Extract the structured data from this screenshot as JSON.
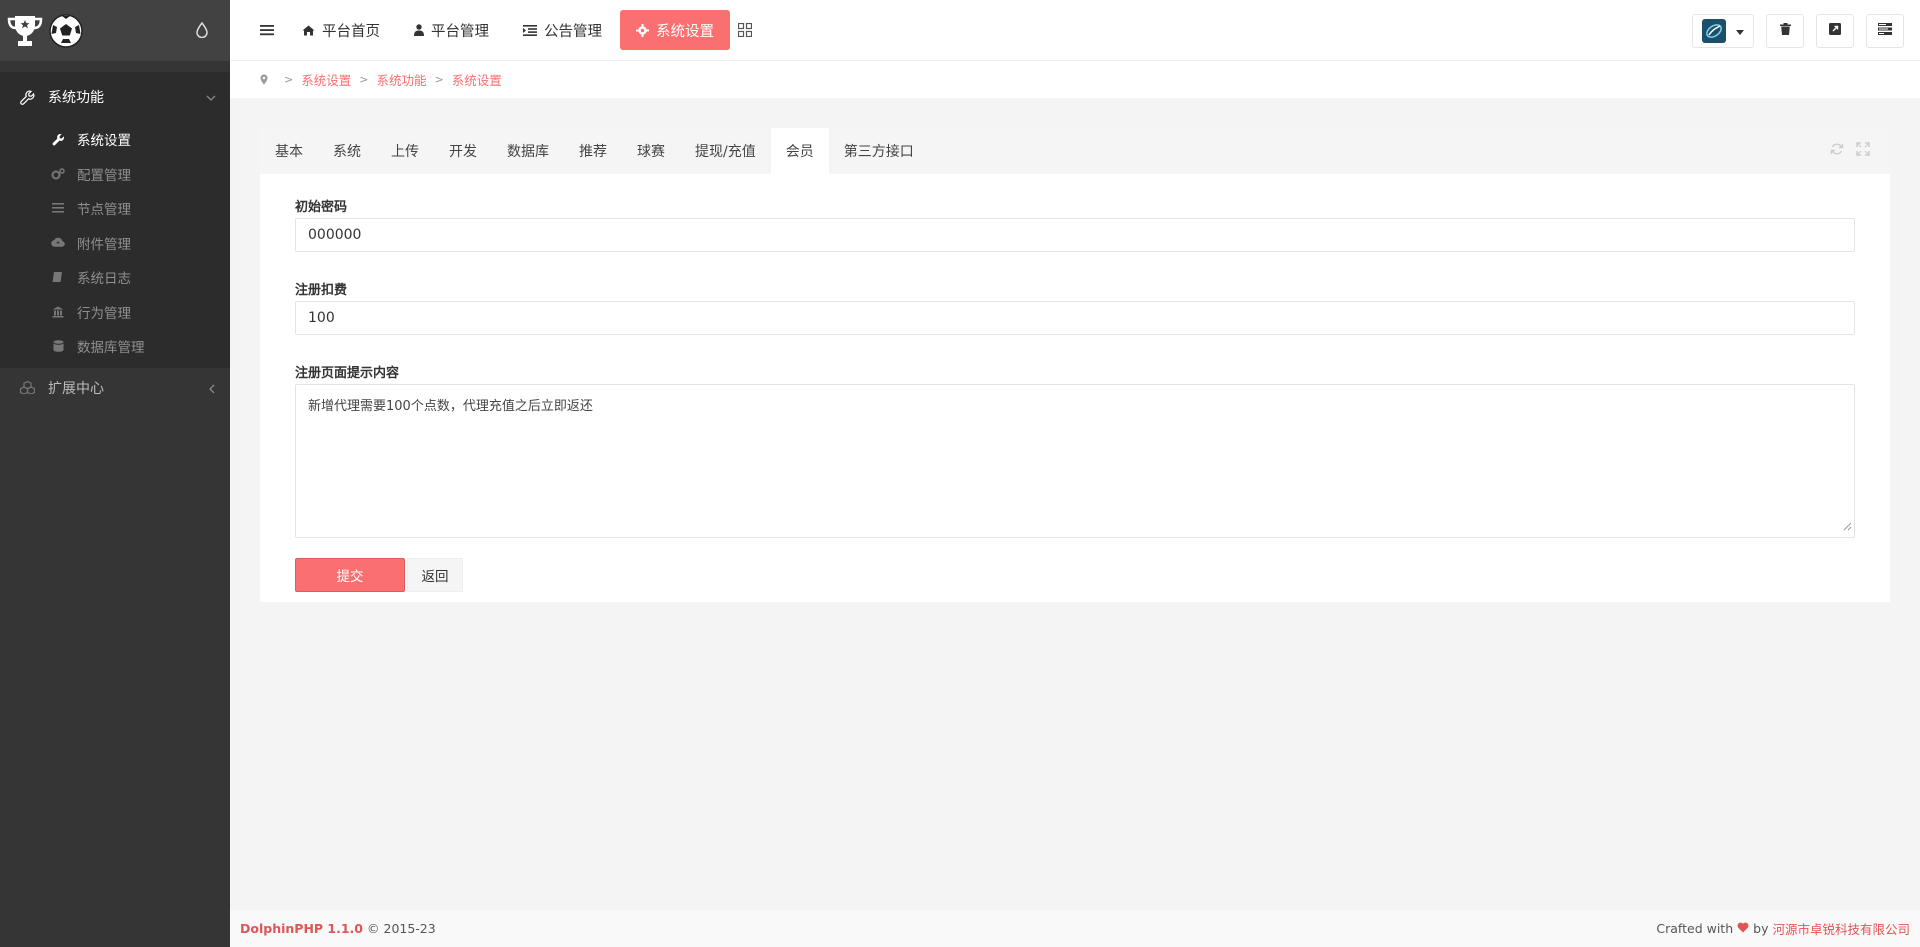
{
  "sidebar": {
    "group_label": "系统功能",
    "items": [
      {
        "label": "系统设置"
      },
      {
        "label": "配置管理"
      },
      {
        "label": "节点管理"
      },
      {
        "label": "附件管理"
      },
      {
        "label": "系统日志"
      },
      {
        "label": "行为管理"
      },
      {
        "label": "数据库管理"
      }
    ],
    "group2_label": "扩展中心"
  },
  "topnav": {
    "items": [
      {
        "label": "平台首页",
        "icon": "home-icon"
      },
      {
        "label": "平台管理",
        "icon": "user-icon"
      },
      {
        "label": "公告管理",
        "icon": "list-indent-icon"
      },
      {
        "label": "系统设置",
        "icon": "gear-icon"
      }
    ],
    "active": "系统设置"
  },
  "breadcrumb": [
    "系统设置",
    "系统功能",
    "系统设置"
  ],
  "tabs": [
    "基本",
    "系统",
    "上传",
    "开发",
    "数据库",
    "推荐",
    "球赛",
    "提现/充值",
    "会员",
    "第三方接口"
  ],
  "active_tab": "会员",
  "form": {
    "init_password": {
      "label": "初始密码",
      "value": "000000"
    },
    "register_fee": {
      "label": "注册扣费",
      "value": "100"
    },
    "register_tip": {
      "label": "注册页面提示内容",
      "value": "新增代理需要100个点数，代理充值之后立即返还"
    },
    "submit_label": "提交",
    "back_label": "返回"
  },
  "footer": {
    "brand": "DolphinPHP 1.1.0",
    "copyright": "© 2015-23",
    "crafted_with": "Crafted with",
    "by": "by",
    "company": "河源市卓锐科技有限公司"
  },
  "colors": {
    "accent": "#fa6f6f",
    "sidebar_bg": "#353535"
  }
}
